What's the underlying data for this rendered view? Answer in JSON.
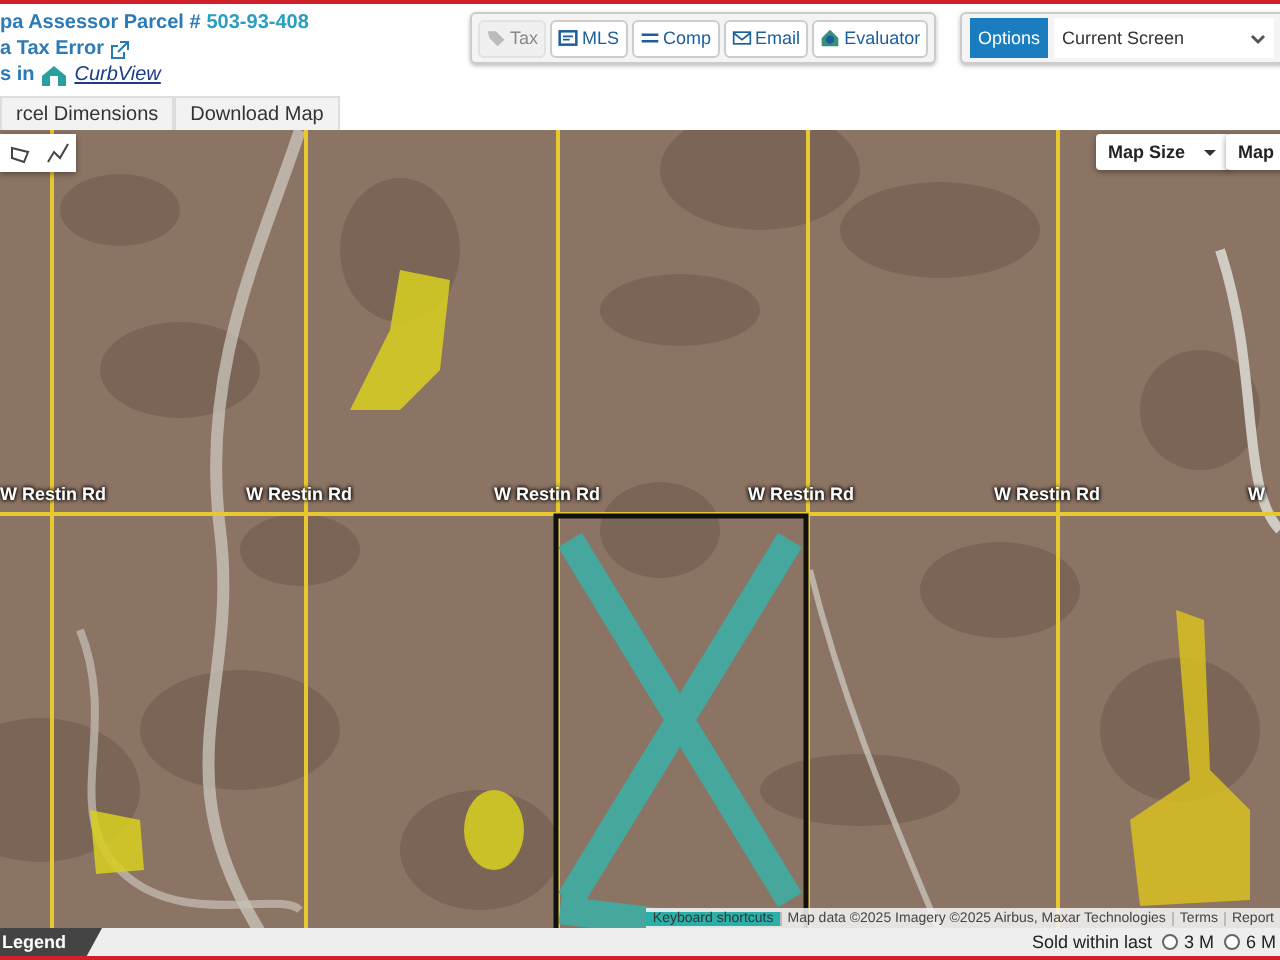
{
  "header": {
    "parcel_label": "pa Assessor Parcel # ",
    "parcel_number": "503-93-408",
    "tax_error_link": "a Tax Error",
    "curbview_prefix": "s in",
    "curbview_link": "CurbView",
    "tabs": [
      {
        "label": "rcel Dimensions"
      },
      {
        "label": "Download Map"
      }
    ]
  },
  "actions": [
    {
      "kind": "tag",
      "label": "Tax",
      "disabled": true
    },
    {
      "kind": "card",
      "label": "MLS",
      "disabled": false
    },
    {
      "kind": "equals",
      "label": "Comp",
      "disabled": false
    },
    {
      "kind": "envelope",
      "label": "Email",
      "disabled": false
    },
    {
      "kind": "house",
      "label": "Evaluator",
      "disabled": false
    }
  ],
  "options": {
    "button": "Options",
    "select_value": "Current Screen"
  },
  "map": {
    "controls": [
      {
        "label": "Map Size",
        "dropdown": true
      },
      {
        "label": "Map ",
        "dropdown": false
      }
    ],
    "road_labels": [
      "W Restin Rd",
      "W Restin Rd",
      "W Restin Rd",
      "W Restin Rd",
      "W Restin Rd",
      "W"
    ],
    "attribution": [
      "Keyboard shortcuts",
      "Map data ©2025 Imagery ©2025 Airbus, Maxar Technologies",
      "Terms",
      "Report"
    ]
  },
  "footer": {
    "legend": "Legend",
    "sold_label": "Sold within last",
    "periods": [
      {
        "label": "3 M",
        "selected": false
      },
      {
        "label": "6 M",
        "selected": false
      }
    ]
  }
}
